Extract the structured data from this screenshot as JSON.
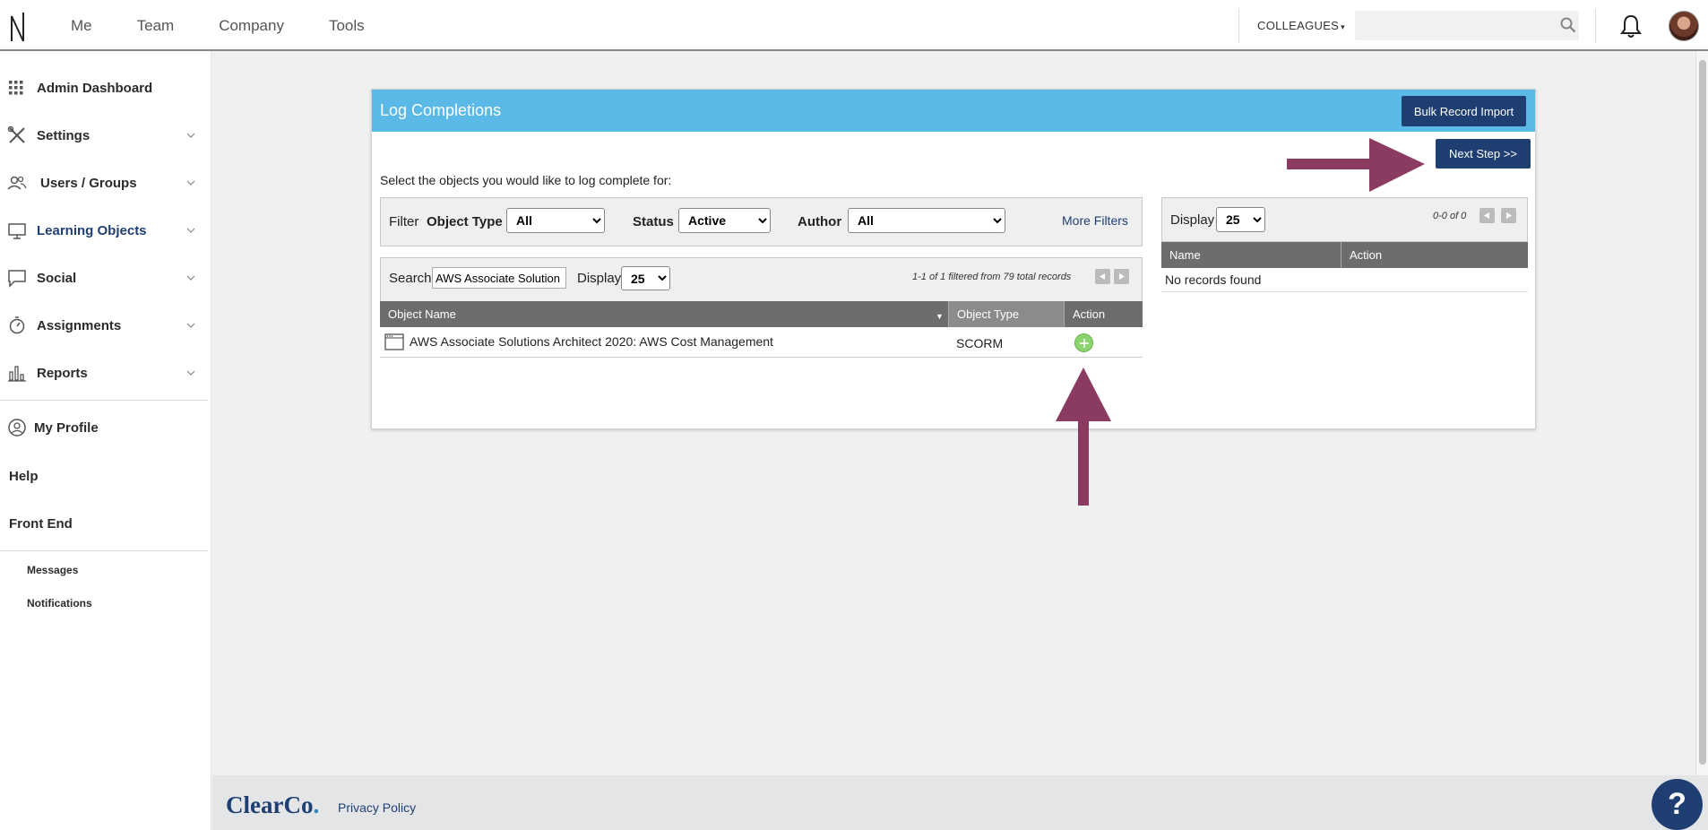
{
  "topnav": {
    "items": [
      "Me",
      "Team",
      "Company",
      "Tools"
    ],
    "colleagues_label": "COLLEAGUES",
    "search_placeholder": ""
  },
  "sidebar": {
    "items": [
      {
        "label": "Admin Dashboard",
        "icon": "grid-icon"
      },
      {
        "label": "Settings",
        "icon": "tools-icon"
      },
      {
        "label": "Users / Groups",
        "icon": "users-icon"
      },
      {
        "label": "Learning Objects",
        "icon": "monitor-icon"
      },
      {
        "label": "Social",
        "icon": "chat-bubble-icon"
      },
      {
        "label": "Assignments",
        "icon": "stopwatch-icon"
      },
      {
        "label": "Reports",
        "icon": "bar-chart-icon"
      },
      {
        "label": "My Profile",
        "icon": "user-circle-icon"
      },
      {
        "label": "Help"
      },
      {
        "label": "Front End"
      }
    ],
    "sub_links": [
      "Messages",
      "Notifications"
    ]
  },
  "panel": {
    "title": "Log Completions",
    "bulk_import_label": "Bulk Record Import",
    "next_step_label": "Next Step >>",
    "instructions": "Select the objects you would like to log complete for:",
    "filter": {
      "filter_label": "Filter",
      "object_type_label": "Object Type",
      "object_type_value": "All",
      "status_label": "Status",
      "status_value": "Active",
      "author_label": "Author",
      "author_value": "All",
      "more_filters_label": "More Filters"
    },
    "search": {
      "search_label": "Search",
      "search_value": "AWS Associate Solution",
      "display_label": "Display",
      "display_value": "25",
      "records_text": "1-1 of 1 filtered from 79 total records"
    },
    "table": {
      "columns": [
        "Object Name",
        "Object Type",
        "Action"
      ],
      "rows": [
        {
          "name": "AWS Associate Solutions Architect 2020: AWS Cost Management",
          "type": "SCORM"
        }
      ]
    },
    "selected": {
      "display_label": "Display",
      "display_value": "25",
      "count_text": "0-0 of 0",
      "columns": [
        "Name",
        "Action"
      ],
      "empty_text": "No records found"
    }
  },
  "footer": {
    "brand_main": "ClearCo",
    "brand_dot": ".",
    "privacy_label": "Privacy Policy"
  },
  "help_fab_label": "?",
  "colors": {
    "header_blue": "#5bb9e8",
    "navy": "#1f3f73",
    "annotation_arrow": "#8b3a62",
    "add_green": "#8bd36d"
  }
}
